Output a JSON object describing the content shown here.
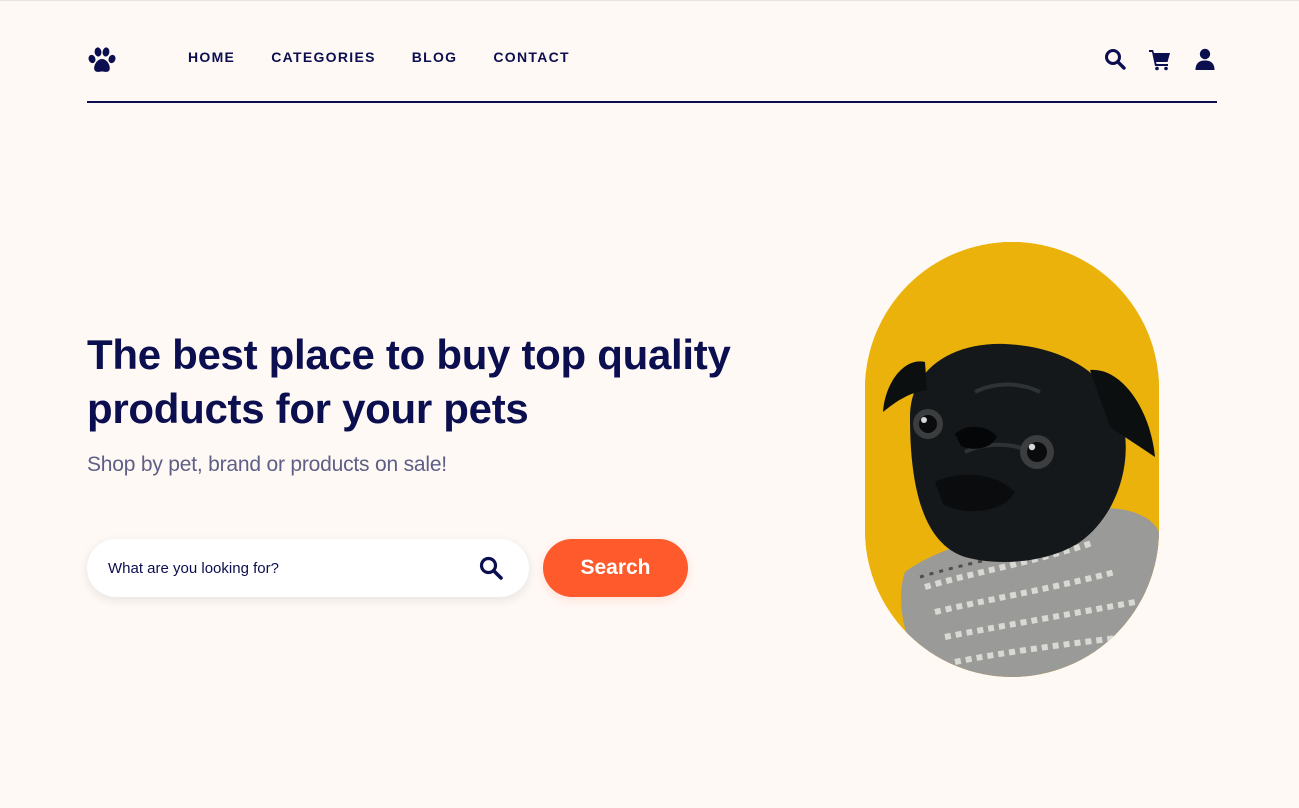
{
  "nav": {
    "logo": "paw-icon",
    "links": [
      "HOME",
      "CATEGORIES",
      "BLOG",
      "CONTACT"
    ],
    "icons": [
      "search-icon",
      "cart-icon",
      "user-icon"
    ]
  },
  "hero": {
    "title": "The best place to buy top quality products for your pets",
    "subtitle": "Shop by pet, brand or products on sale!",
    "search": {
      "placeholder": "What are you looking for?",
      "button_label": "Search"
    },
    "image": "pug-photo"
  },
  "colors": {
    "navy": "#0b0e4f",
    "accent": "#ff5a2c",
    "background": "#fff9f5",
    "image_bg": "#eab20b",
    "subtitle": "#5e5f86"
  }
}
